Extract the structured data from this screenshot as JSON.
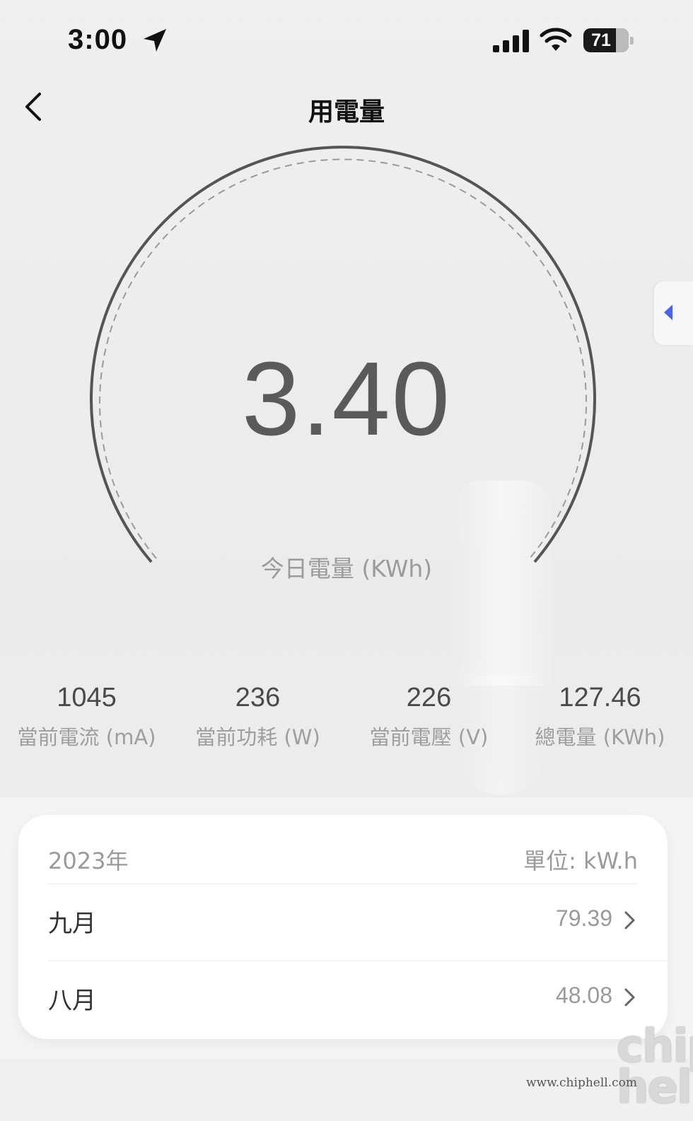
{
  "status_bar": {
    "time": "3:00",
    "battery": "71",
    "icons": [
      "location-arrow-icon",
      "cellular-signal-icon",
      "wifi-icon",
      "battery-icon"
    ]
  },
  "nav": {
    "title": "用電量",
    "back_icon": "chevron-left-icon"
  },
  "gauge": {
    "value": "3.40",
    "label": "今日電量 (KWh)"
  },
  "side_tab": {
    "icon": "triangle-left-icon",
    "accent_color": "#4a63e8"
  },
  "stats": [
    {
      "value": "1045",
      "label": "當前電流 (mA)"
    },
    {
      "value": "236",
      "label": "當前功耗 (W)"
    },
    {
      "value": "226",
      "label": "當前電壓 (V)"
    },
    {
      "value": "127.46",
      "label": "總電量 (KWh)"
    }
  ],
  "monthly": {
    "year": "2023年",
    "unit": "單位: kW.h",
    "rows": [
      {
        "month": "九月",
        "value": "79.39"
      },
      {
        "month": "八月",
        "value": "48.08"
      }
    ]
  },
  "watermark": {
    "logo": "chip hell",
    "url": "www.chiphell.com"
  }
}
